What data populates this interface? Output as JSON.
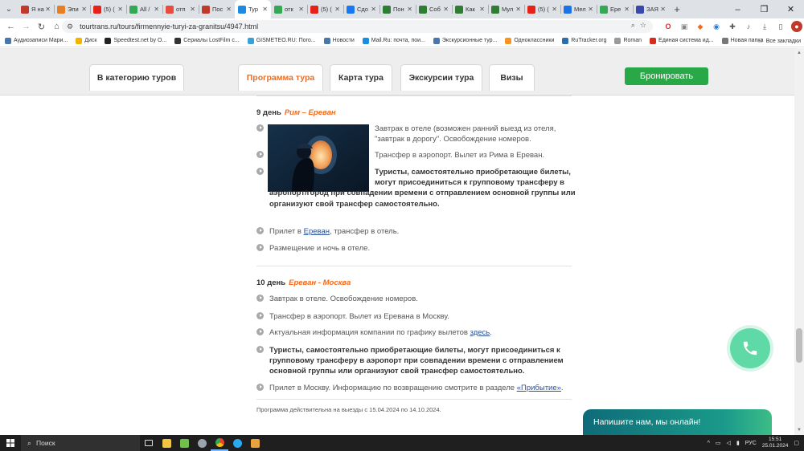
{
  "browser": {
    "tabs": [
      {
        "label": "Я на",
        "color": "#c0392b"
      },
      {
        "label": "Эпи",
        "color": "#e67e22"
      },
      {
        "label": "(5) (",
        "color": "#e62117"
      },
      {
        "label": "All /",
        "color": "#34a853"
      },
      {
        "label": "отп",
        "color": "#e74c3c"
      },
      {
        "label": "Пос",
        "color": "#c0392b"
      },
      {
        "label": "Тур",
        "color": "#1e88e5",
        "active": true
      },
      {
        "label": "отк",
        "color": "#34a853"
      },
      {
        "label": "(5) (",
        "color": "#e62117"
      },
      {
        "label": "Сдо",
        "color": "#1877f2"
      },
      {
        "label": "Пон",
        "color": "#2e7d32"
      },
      {
        "label": "Соб",
        "color": "#2e7d32"
      },
      {
        "label": "Как",
        "color": "#2e7d32"
      },
      {
        "label": "Мул",
        "color": "#2e7d32"
      },
      {
        "label": "(5) (",
        "color": "#e62117"
      },
      {
        "label": "Мел",
        "color": "#1a73e8"
      },
      {
        "label": "Ере",
        "color": "#34a853"
      },
      {
        "label": "ЗАЯ",
        "color": "#3949ab"
      }
    ],
    "new_tab": "+",
    "url": "tourtrans.ru/tours/firmennyie-turyi-za-granitsu/4947.html",
    "bookmarks": [
      {
        "label": "Аудиозаписи Мари...",
        "color": "#4a76a8"
      },
      {
        "label": "Диск",
        "color": "#f2b400"
      },
      {
        "label": "Speedtest.net by O...",
        "color": "#222222"
      },
      {
        "label": "Сериалы LostFilm с...",
        "color": "#333333"
      },
      {
        "label": "GISMETEO.RU: Пого...",
        "color": "#3aa0d8"
      },
      {
        "label": "Новости",
        "color": "#4a76a8"
      },
      {
        "label": "Mail.Ru: почта, пои...",
        "color": "#168de2"
      },
      {
        "label": "Экскурсионные тур...",
        "color": "#4a76a8"
      },
      {
        "label": "Одноклассники",
        "color": "#f7931e"
      },
      {
        "label": "RuTracker.org",
        "color": "#2d6ea8"
      },
      {
        "label": "Roman",
        "color": "#999999"
      },
      {
        "label": "Единая система ид...",
        "color": "#d52b1e"
      },
      {
        "label": "Новая папка",
        "color": "#777777"
      }
    ],
    "all_bookmarks": "Все закладки"
  },
  "site": {
    "nav": [
      {
        "label": "В категорию туров"
      },
      {
        "label": "Программа тура",
        "current": true
      },
      {
        "label": "Карта тура"
      },
      {
        "label": "Экскурсии тура"
      },
      {
        "label": "Визы"
      }
    ],
    "book_button": "Бронировать"
  },
  "program": {
    "day9": {
      "number": "9 день",
      "route": "Рим – Ереван",
      "items": [
        "Завтрак в отеле (возможен ранний выезд из отеля, \"завтрак в дорогу\". Освобождение номеров.",
        "Трансфер в аэропорт. Вылет из Рима в Ереван.",
        "Туристы, самостоятельно приобретающие билеты, могут присоединиться к групповому трансферу в аэропорт/город при совпадении времени с отправлением основной группы или организуют свой трансфер самостоятельно."
      ],
      "arrival_before": "Прилет в ",
      "arrival_link": "Ереван",
      "arrival_after": ", трансфер в отель.",
      "accommodation": "Размещение и ночь в отеле."
    },
    "day10": {
      "number": "10 день",
      "route": "Ереван - Москва",
      "items": [
        "Завтрак в отеле. Освобождение номеров.",
        "Трансфер в аэропорт. Вылет из Еревана в Москву."
      ],
      "info_before": "Актуальная информация компании по графику вылетов ",
      "info_link": "здесь",
      "info_after": ".",
      "bold_note": "Туристы, самостоятельно приобретающие билеты, могут присоединиться к групповому трансферу в аэропорт при совпадении времени с отправлением основной группы или организуют свой трансфер самостоятельно.",
      "return_before": "Прилет в Москву. Информацию по возвращению смотрите в разделе ",
      "return_link": "«Прибытие»",
      "return_after": "."
    },
    "validity": "Программа действительна на выезды с 15.04.2024 по 14.10.2024."
  },
  "widgets": {
    "chat": "Напишите нам, мы онлайн!"
  },
  "taskbar": {
    "search": "Поиск",
    "language": "РУС",
    "time": "15:51",
    "date": "25.01.2024"
  }
}
